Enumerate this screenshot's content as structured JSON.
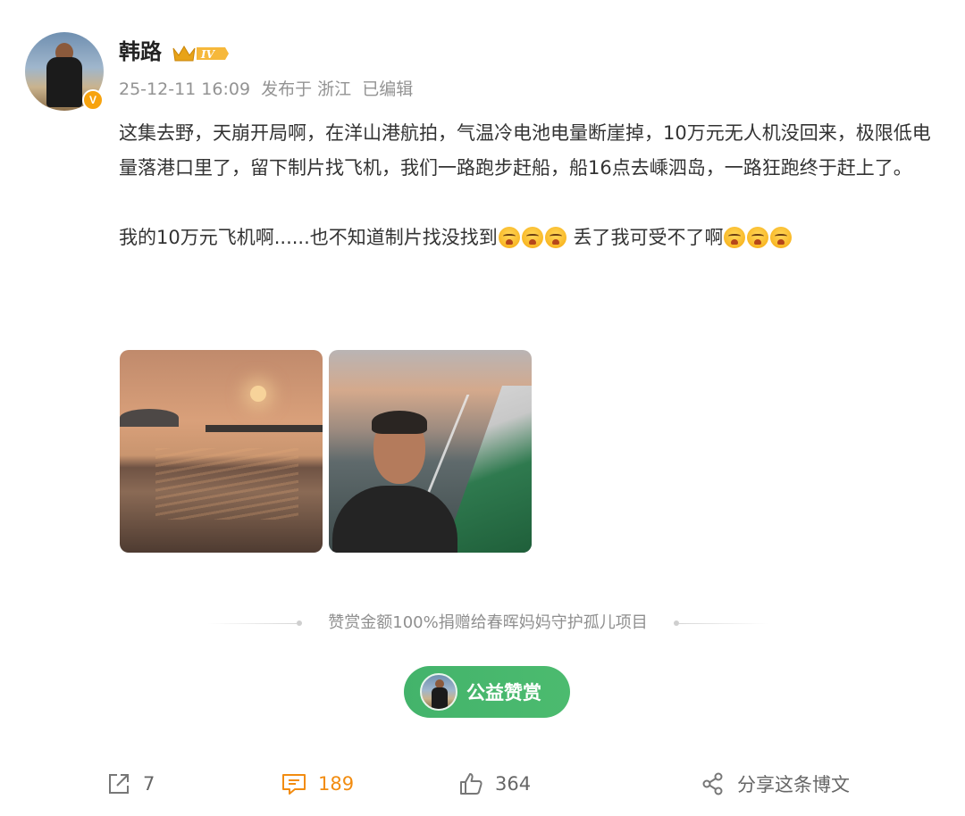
{
  "author": {
    "name": "韩路",
    "verified_badge": "V",
    "level_badge": "IV"
  },
  "meta": {
    "timestamp": "25-12-11 16:09",
    "location": "发布于 浙江",
    "edited": "已编辑"
  },
  "post": {
    "paragraph1": "这集去野，天崩开局啊，在洋山港航拍，气温冷电池电量断崖掉，10万元无人机没回来，极限低电量落港口里了，留下制片找飞机，我们一路跑步赶船，船16点去嵊泗岛，一路狂跑终于赶上了。",
    "paragraph2_a": "我的10万元飞机啊......也不知道制片找没找到",
    "paragraph2_b": " 丢了我可受不了啊",
    "emoji_name": "cry-emoji"
  },
  "photos": [
    {
      "name": "sunset-sea-photo"
    },
    {
      "name": "ferry-selfie-photo"
    }
  ],
  "reward": {
    "note": "赞赏金额100%捐赠给春晖妈妈守护孤儿项目",
    "button_label": "公益赞赏",
    "button_color": "#43b36b"
  },
  "actions": {
    "repost_count": "7",
    "comment_count": "189",
    "like_count": "364",
    "share_label": "分享这条博文",
    "comment_color": "#f28c10"
  }
}
